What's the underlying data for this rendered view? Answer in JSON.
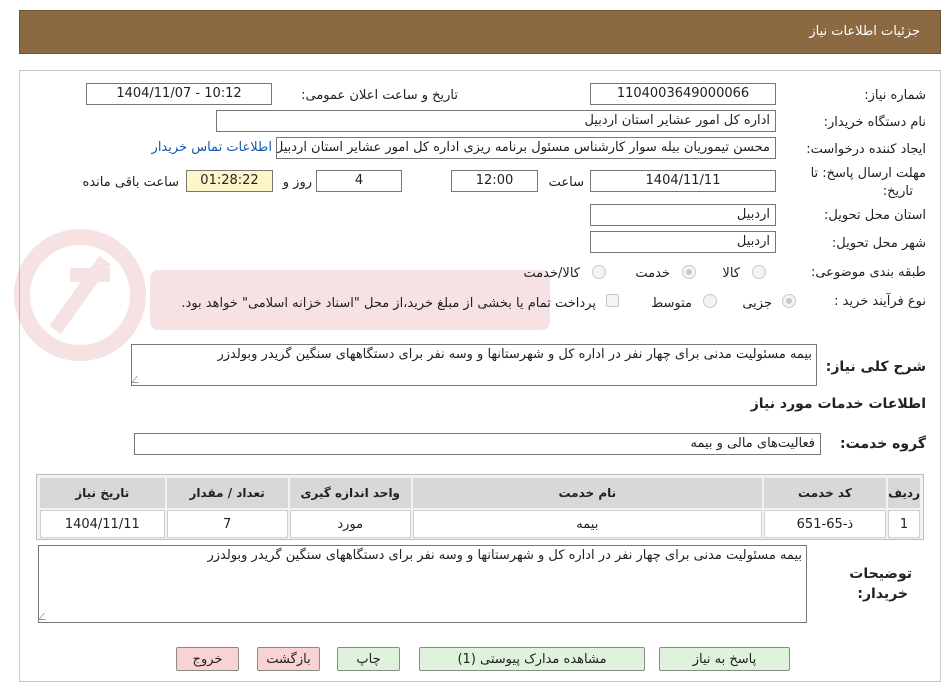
{
  "header": {
    "title": "جزئیات اطلاعات نیاز"
  },
  "form": {
    "need_number_label": "شماره نیاز:",
    "need_number": "1104003649000066",
    "announce_label": "تاریخ و ساعت اعلان عمومی:",
    "announce_value": "1404/11/07 - 10:12",
    "buyer_org_label": "نام دستگاه خریدار:",
    "buyer_org": "اداره کل امور عشایر استان اردبیل",
    "requester_label": "ایجاد کننده درخواست:",
    "requester": "محسن تیموریان بیله سوار کارشناس مسئول برنامه ریزی اداره کل امور عشایر استان اردبیل",
    "contact_link": "اطلاعات تماس خریدار",
    "deadline_label_1": "مهلت ارسال پاسخ: تا",
    "deadline_label_2": "تاریخ:",
    "deadline_date": "1404/11/11",
    "time_label": "ساعت",
    "deadline_time": "12:00",
    "days_value": "4",
    "days_label": "روز و",
    "remaining_time": "01:28:22",
    "remaining_label": "ساعت باقی مانده",
    "province_label": "استان محل تحویل:",
    "province": "اردبیل",
    "city_label": "شهر محل تحویل:",
    "city": "اردبیل",
    "category_label": "طبقه بندی موضوعی:",
    "category_options": [
      "کالا",
      "خدمت",
      "کالا/خدمت"
    ],
    "process_label": "نوع فرآیند خرید :",
    "process_options": [
      "جزیی",
      "متوسط"
    ],
    "payment_note": "پرداخت تمام یا بخشی از مبلغ خرید،از محل \"اسناد خزانه اسلامی\" خواهد بود.",
    "summary_label": "شرح کلی نیاز:",
    "summary": "بیمه مسئولیت مدنی برای چهار نفر در اداره کل و شهرستانها و وسه نفر برای دستگاههای سنگین گریدر وبولدزر",
    "services_heading": "اطلاعات خدمات مورد نیاز",
    "service_group_label": "گروه خدمت:",
    "service_group": "فعالیت‌های مالی و بیمه"
  },
  "table": {
    "headers": [
      "ردیف",
      "کد خدمت",
      "نام خدمت",
      "واحد اندازه گیری",
      "تعداد / مقدار",
      "تاریخ نیاز"
    ],
    "rows": [
      [
        "1",
        "ذ-65-651",
        "بیمه",
        "مورد",
        "7",
        "1404/11/11"
      ]
    ]
  },
  "buyer_notes_label": "توضیحات خریدار:",
  "buyer_notes": "بیمه مسئولیت مدنی برای چهار نفر در اداره کل و شهرستانها و وسه نفر برای دستگاههای سنگین گریدر وبولدزر",
  "buttons": {
    "reply": "پاسخ به نیاز",
    "attachments": "مشاهده مدارک پیوستی (1)",
    "print": "چاپ",
    "back": "بازگشت",
    "exit": "خروج"
  },
  "colors": {
    "header_bg": "#8b6a43",
    "link": "#1558b0",
    "button_green": "#dff3dc",
    "button_pink": "#f9d3d3",
    "remaining_bg": "#fdf6c9"
  }
}
